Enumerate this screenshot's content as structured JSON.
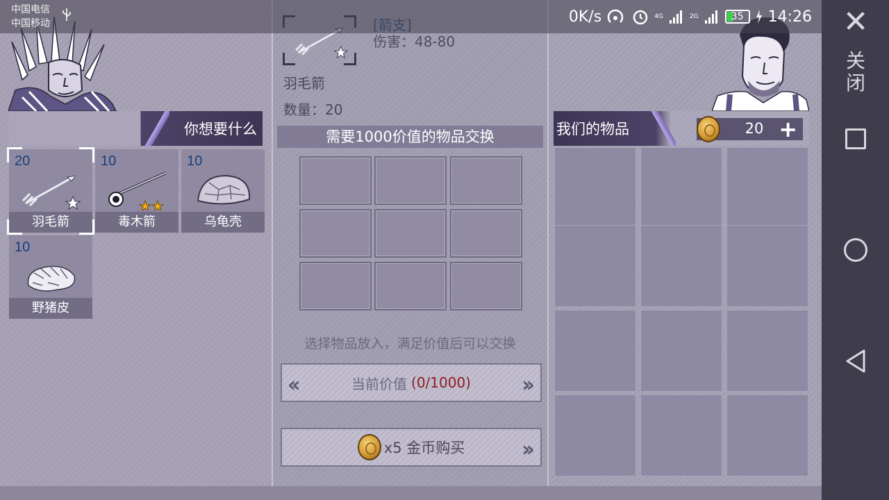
{
  "status_bar": {
    "carrier_1": "中国电信",
    "carrier_2": "中国移动",
    "net_speed": "0K/s",
    "sig_1": "4G",
    "sig_2": "2G",
    "battery": "35",
    "time": "14:26"
  },
  "left_panel": {
    "header": "你想要什么",
    "items": [
      {
        "count": "20",
        "name": "羽毛箭",
        "stars": 1,
        "icon": "feather-arrow-icon"
      },
      {
        "count": "10",
        "name": "毒木箭",
        "stars": 2,
        "icon": "poison-arrow-icon"
      },
      {
        "count": "10",
        "name": "乌龟壳",
        "stars": 0,
        "icon": "turtle-shell-icon"
      },
      {
        "count": "10",
        "name": "野猪皮",
        "stars": 0,
        "icon": "boar-hide-icon"
      }
    ]
  },
  "detail": {
    "type": "[箭支]",
    "damage": "伤害：48-80",
    "name": "羽毛箭",
    "quantity": "数量：20"
  },
  "exchange": {
    "title": "需要1000价值的物品交换",
    "hint": "选择物品放入，满足价值后可以交换",
    "value_label": "当前价值",
    "value": "(0/1000)",
    "buy_label": "x5 金币购买"
  },
  "right_panel": {
    "header": "我们的物品",
    "gold": "20"
  },
  "navbar": {
    "close_text": "关闭"
  },
  "colors": {
    "header_dark": "#3e3556",
    "value_red": "#8e1b1b",
    "count_blue": "#1b3e78",
    "battery_green": "#3bd24a"
  }
}
